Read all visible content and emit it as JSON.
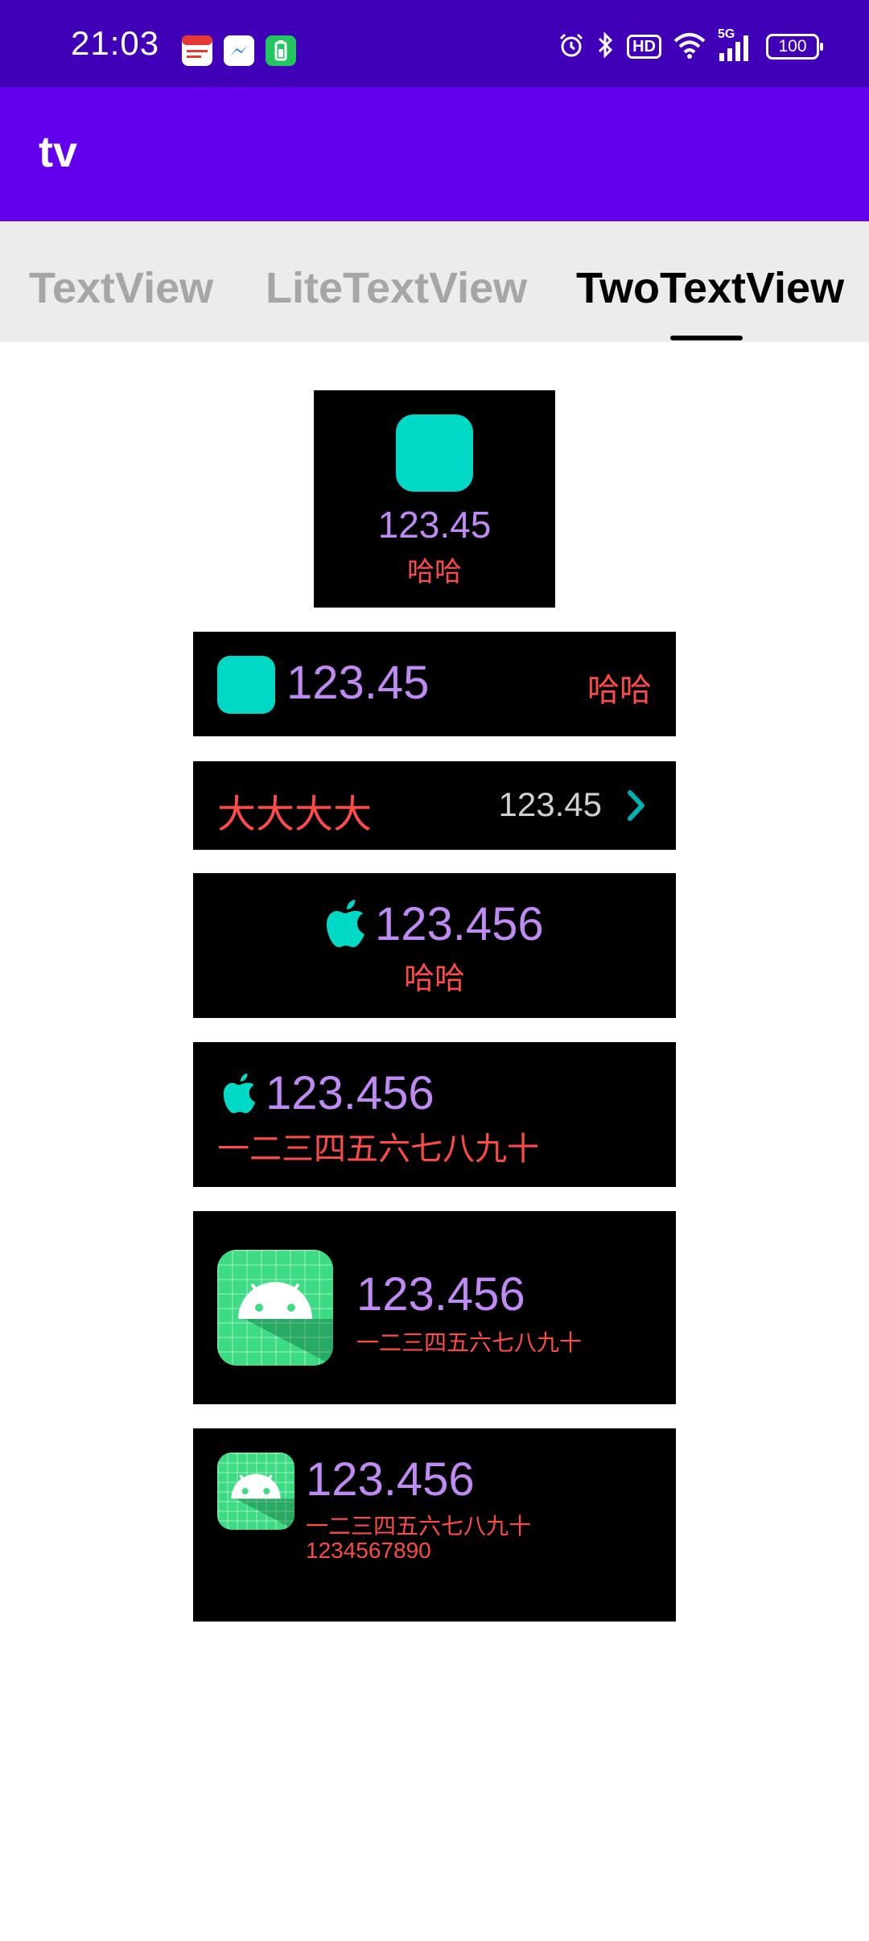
{
  "status_bar": {
    "time": "21:03",
    "notification_icons": [
      "calendar-icon",
      "messenger-icon",
      "battery-saver-icon"
    ],
    "right_icons": [
      "alarm-icon",
      "bluetooth-icon",
      "hd-icon",
      "wifi-icon",
      "5g-signal-icon"
    ],
    "hd_label": "HD",
    "signal_label": "5G",
    "battery": "100"
  },
  "app_bar": {
    "title": "tv"
  },
  "tabs": [
    {
      "label": "TextView",
      "active": false
    },
    {
      "label": "LiteTextView",
      "active": false
    },
    {
      "label": "TwoTextView",
      "active": true
    }
  ],
  "cards": {
    "card1": {
      "top": "123.45",
      "bottom": "哈哈",
      "icon": "teal-square-icon"
    },
    "card2": {
      "main": "123.45",
      "right": "哈哈",
      "icon": "teal-square-icon"
    },
    "card3": {
      "left": "大大大大",
      "right": "123.45",
      "icon": "chevron-right-icon"
    },
    "card4": {
      "main": "123.456",
      "sub": "哈哈",
      "icon": "apple-icon"
    },
    "card5": {
      "main": "123.456",
      "sub": "一二三四五六七八九十",
      "icon": "apple-icon"
    },
    "card6": {
      "main": "123.456",
      "sub": "一二三四五六七八九十",
      "icon": "android-icon"
    },
    "card7": {
      "main": "123.456",
      "sub": "一二三四五六七八九十",
      "sub2": "1234567890",
      "icon": "android-icon"
    }
  },
  "colors": {
    "status_bar": "#3f00b8",
    "app_bar": "#6200ee",
    "accent_teal": "#00d9c5",
    "number_purple": "#c08af4",
    "label_red": "#ff4a4a",
    "android_green": "#3ddc84"
  }
}
